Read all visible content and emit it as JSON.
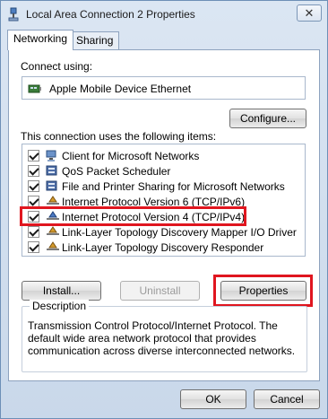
{
  "window": {
    "title": "Local Area Connection 2 Properties",
    "close_glyph": "✕"
  },
  "tabs": [
    {
      "label": "Networking",
      "active": true
    },
    {
      "label": "Sharing",
      "active": false
    }
  ],
  "networking": {
    "connect_using_label": "Connect using:",
    "adapter_name": "Apple Mobile Device Ethernet",
    "configure_label": "Configure...",
    "items_label": "This connection uses the following items:",
    "items": [
      {
        "label": "Client for Microsoft Networks",
        "checked": true,
        "icon": "network-client-icon"
      },
      {
        "label": "QoS Packet Scheduler",
        "checked": true,
        "icon": "service-icon"
      },
      {
        "label": "File and Printer Sharing for Microsoft Networks",
        "checked": true,
        "icon": "service-icon"
      },
      {
        "label": "Internet Protocol Version 6 (TCP/IPv6)",
        "checked": true,
        "icon": "protocol-icon"
      },
      {
        "label": "Internet Protocol Version 4 (TCP/IPv4)",
        "checked": true,
        "icon": "protocol-icon"
      },
      {
        "label": "Link-Layer Topology Discovery Mapper I/O Driver",
        "checked": true,
        "icon": "protocol-icon"
      },
      {
        "label": "Link-Layer Topology Discovery Responder",
        "checked": true,
        "icon": "protocol-icon"
      }
    ],
    "install_label": "Install...",
    "uninstall_label": "Uninstall",
    "properties_label": "Properties",
    "description_label": "Description",
    "description_text": "Transmission Control Protocol/Internet Protocol. The default wide area network protocol that provides communication across diverse interconnected networks."
  },
  "footer": {
    "ok_label": "OK",
    "cancel_label": "Cancel"
  },
  "colors": {
    "highlight": "#e0161f",
    "window_bg": "#cfdbe9"
  }
}
